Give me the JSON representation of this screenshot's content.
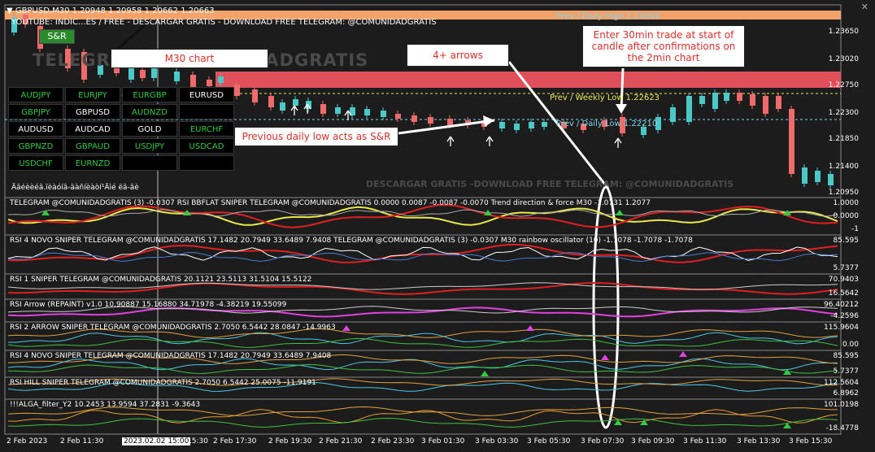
{
  "chart_header": {
    "symbol_line": "GBPUSD,M30  1.20948 1.20958 1.20662 1.20663",
    "youtube_line": "YOUTUBE: INDIC...ES / FREE - DESCARGAR GRATIS - DOWNLOAD FREE TELEGRAM: @COMUNIDADGRATIS",
    "snr_button": "S&R",
    "watermark_big": "TELEGRAM @COMUNIDADGRATIS",
    "watermark_mid": "DESCARGAR GRATIS -DOWNLOAD FREE TELEGRAM: @COMUNIDADGRATIS",
    "garbled_text": "Äâéèèéâ.ïèàóíâ-äàñíèàòí¹Äìé ëâ-âè",
    "close_glyph": "✕"
  },
  "symbols": [
    {
      "label": "AUDJPY",
      "color": "green"
    },
    {
      "label": "EURJPY",
      "color": "green"
    },
    {
      "label": "EURGBP",
      "color": "green"
    },
    {
      "label": "EURUSD",
      "color": "white"
    },
    {
      "label": "GBPJPY",
      "color": "green"
    },
    {
      "label": "GBPUSD",
      "color": "white"
    },
    {
      "label": "AUDNZD",
      "color": "green"
    },
    {
      "label": "",
      "color": "white"
    },
    {
      "label": "AUDUSD",
      "color": "white"
    },
    {
      "label": "AUDCAD",
      "color": "white"
    },
    {
      "label": "GOLD",
      "color": "white"
    },
    {
      "label": "EURCHF",
      "color": "green"
    },
    {
      "label": "GBPNZD",
      "color": "green"
    },
    {
      "label": "GBPAUD",
      "color": "green"
    },
    {
      "label": "USDJPY",
      "color": "green"
    },
    {
      "label": "USDCAD",
      "color": "green"
    },
    {
      "label": "USDCHF",
      "color": "green"
    },
    {
      "label": "EURNZD",
      "color": "green"
    },
    {
      "label": "",
      "color": "white"
    },
    {
      "label": "",
      "color": "white"
    }
  ],
  "levels": {
    "daily_high": "Prev / Daily High 1.24004",
    "weekly_low": "Prev / Weekly Low 1.22623",
    "daily_low": "Prev / Daily Low 1.22210"
  },
  "annotations": {
    "m30": "M30 chart",
    "arrows": "4+ arrows",
    "trade": "Enter 30min trade at start of candle after confirmations on the 2min chart",
    "snr": "Previous daily low acts as S&R"
  },
  "price_axis": [
    "1.23650",
    "1.23020",
    "1.22750",
    "1.22300",
    "1.21850",
    "1.21400",
    "1.20950"
  ],
  "panes": [
    {
      "title": "TELEGRAM @COMUNIDADGRATIS (3) -0.0307  RSI BBFLAT SNIPER TELEGRAM @COMUNIDADGRATIS 0.0000 0.0087 -0.0087 -0.0070  Trend direction & force M30 -1.0731 1.2077",
      "labels": [
        "1.0000",
        "0.0000",
        "-1"
      ]
    },
    {
      "title": "RSI 4 NOVO SNIPER TELEGRAM @COMUNIDADGRATIS 17.1482 20.7949 33.6489 7.9408  TELEGRAM @COMUNIDADGRATIS (3) -0.0307  M30 rainbow oscillator (10) -1.7078 -1.7078 -1.7078",
      "labels": [
        "85.595",
        "5.7377"
      ]
    },
    {
      "title": "RSI 1 SNIPER TELEGRAM @COMUNIDADGRATIS 20.1121 23.5113 31.5104 15.5122",
      "labels": [
        "70.9403",
        "16.5642"
      ]
    },
    {
      "title": "RSI Arrow (REPAINT) v1.0 10.90887 15.16880 34.71978 -4.38219 19.55099",
      "labels": [
        "96.40212",
        "-4.2596"
      ]
    },
    {
      "title": "RSI 2 ARROW SNIPER TELEGRAM @COMUNIDADGRATIS 2.7050 6.5442 28.0847 -14.9963",
      "labels": [
        "115.9604",
        "0.00"
      ]
    },
    {
      "title": "RSI 4 NOVO SNIPER TELEGRAM @COMUNIDADGRATIS 17.1482 20.7949 33.6489 7.9408",
      "labels": [
        "85.595",
        "5.7377"
      ]
    },
    {
      "title": "RSI HILL SNIPER TELEGRAM @COMUNIDADGRATIS 2.7050 6.5442 25.0075 -11.9191",
      "labels": [
        "112.5604",
        "6.8962"
      ]
    },
    {
      "title": "!!!ALGA_filter_Y2 10.2453 13.9594 37.2831 -9.3643",
      "labels": [
        "101.0198",
        "-18.4778"
      ]
    }
  ],
  "time_axis": [
    "2 Feb 2023",
    "2 Feb 11:30",
    "2023.02.02 15:00",
    "15:30",
    "2 Feb 17:30",
    "2 Feb 19:30",
    "2 Feb 21:30",
    "2 Feb 23:30",
    "3 Feb 01:30",
    "3 Feb 03:30",
    "3 Feb 05:30",
    "3 Feb 07:30",
    "3 Feb 09:30",
    "3 Feb 11:30",
    "3 Feb 13:30",
    "3 Feb 15:30"
  ],
  "colors": {
    "bg": "#1c1c1c",
    "bull": "#4bc8c8",
    "bear": "#ef6b6b",
    "high_band": "#f4a26a",
    "resist_band": "#e0505a",
    "annotation_text": "#e0302a"
  }
}
